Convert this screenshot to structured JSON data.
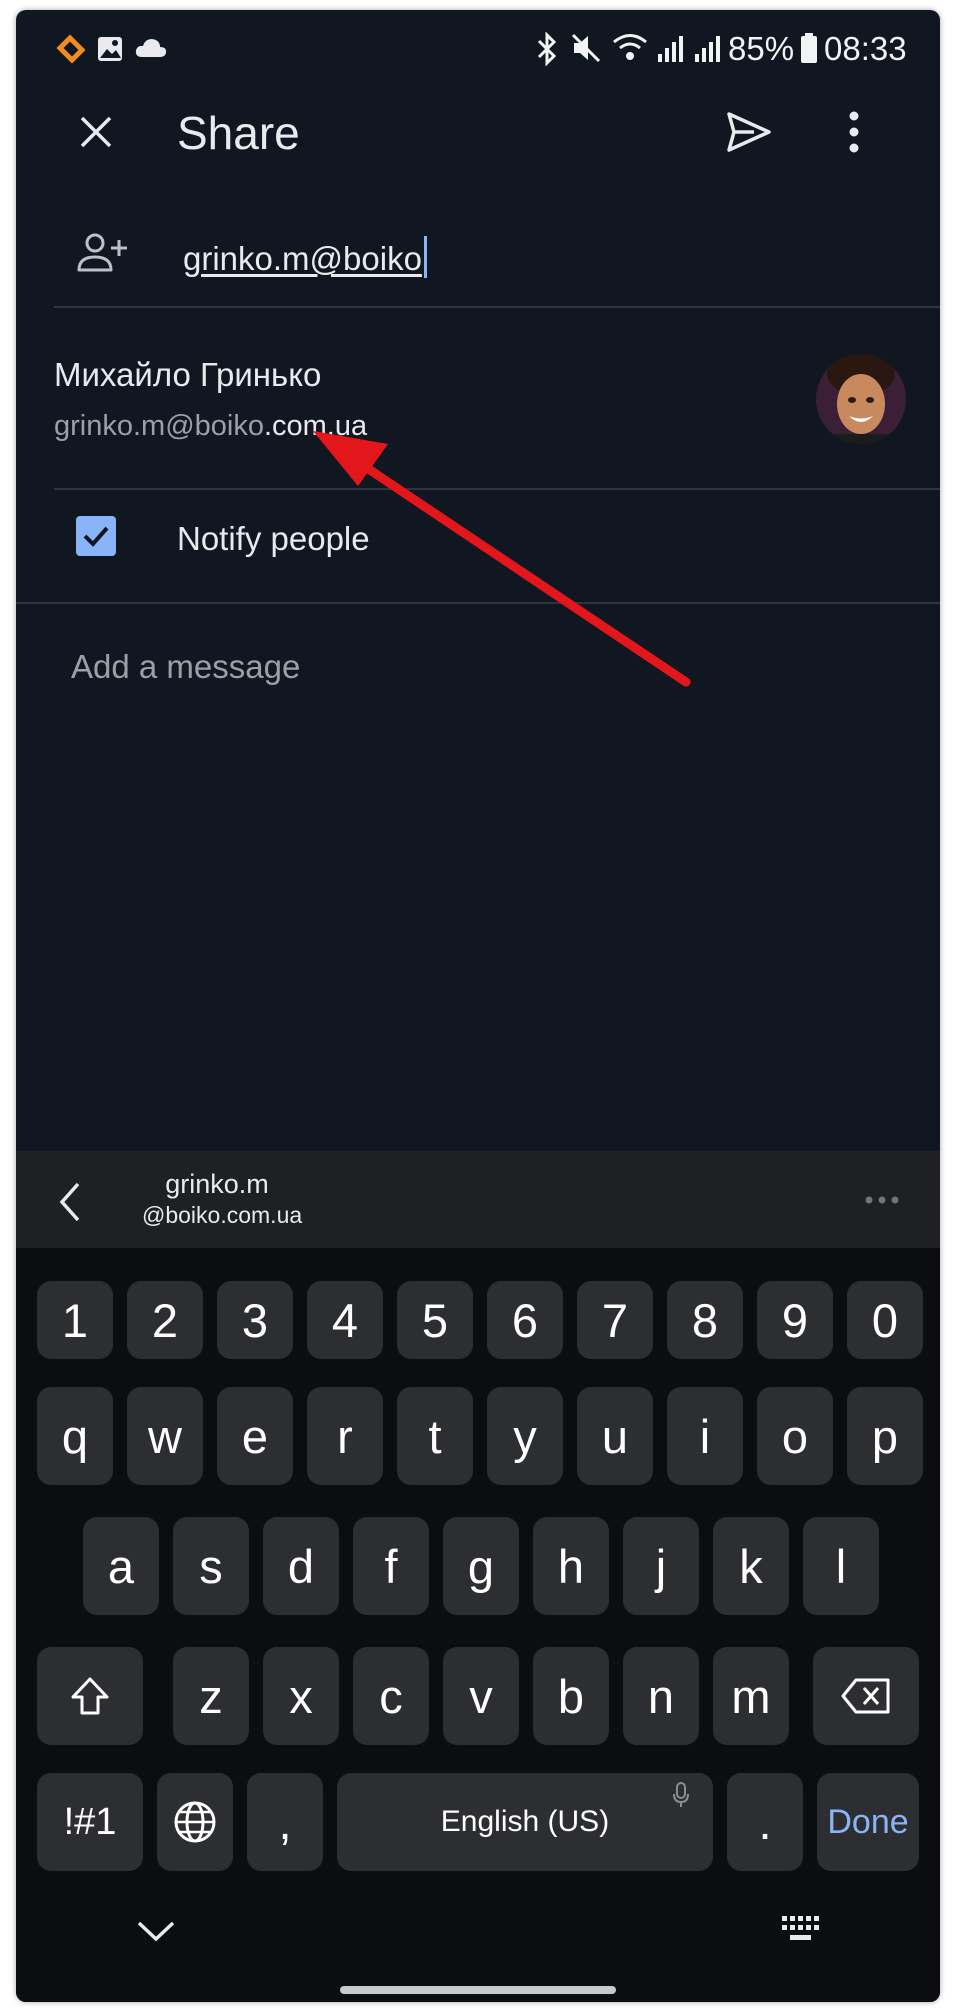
{
  "status_bar": {
    "battery": "85%",
    "time": "08:33",
    "icons": [
      "app-icon",
      "gallery-icon",
      "cloud-icon",
      "bluetooth-icon",
      "mute-icon",
      "wifi-icon",
      "signal-icon",
      "signal-icon",
      "battery-icon"
    ]
  },
  "header": {
    "title": "Share",
    "close_icon": "close-icon",
    "send_icon": "send-icon",
    "more_icon": "more-vertical-icon"
  },
  "recipient_input": {
    "value": "grinko.m@boiko",
    "icon": "add-person-icon"
  },
  "suggestion": {
    "name": "Михайло Гринько",
    "email_typed": "grinko.m@boiko",
    "email_rest": ".com.ua"
  },
  "notify": {
    "label": "Notify people",
    "checked": true
  },
  "message": {
    "placeholder": "Add a message"
  },
  "keyboard": {
    "suggestion_line1": "grinko.m",
    "suggestion_line2": "@boiko.com.ua",
    "number_row": [
      "1",
      "2",
      "3",
      "4",
      "5",
      "6",
      "7",
      "8",
      "9",
      "0"
    ],
    "row1": [
      "q",
      "w",
      "e",
      "r",
      "t",
      "y",
      "u",
      "i",
      "o",
      "p"
    ],
    "row2": [
      "a",
      "s",
      "d",
      "f",
      "g",
      "h",
      "j",
      "k",
      "l"
    ],
    "row3": [
      "z",
      "x",
      "c",
      "v",
      "b",
      "n",
      "m"
    ],
    "symbols_key": "!#1",
    "comma_key": ",",
    "space_label": "English (US)",
    "period_key": ".",
    "done_label": "Done"
  },
  "colors": {
    "background": "#111720",
    "keyboard_bg": "#0b0d10",
    "key_bg": "#2d2e31",
    "accent": "#8ab4f8",
    "annotation_arrow": "#e3161b"
  }
}
